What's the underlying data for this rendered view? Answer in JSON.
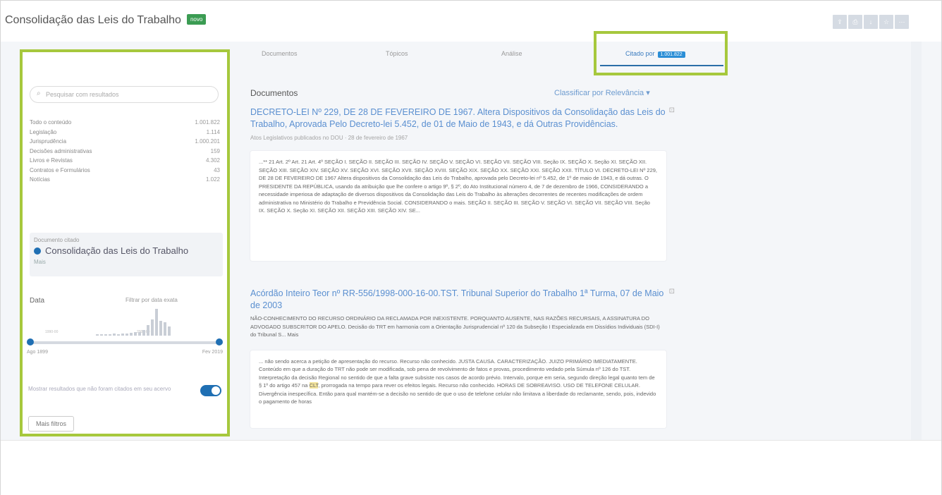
{
  "app": {
    "title": "Consolidação das Leis do Trabalho",
    "badge": "novo",
    "toolbar_icons": [
      "share-icon",
      "print-icon",
      "download-icon",
      "bookmark-icon",
      "more-icon"
    ]
  },
  "sidebar": {
    "search_placeholder": "Pesquisar com resultados",
    "facets": [
      {
        "label": "Todo o conteúdo",
        "count": "1.001.822"
      },
      {
        "label": "Legislação",
        "count": "1.114"
      },
      {
        "label": "Jurisprudência",
        "count": "1.000.201"
      },
      {
        "label": "Decisões administrativas",
        "count": "159"
      },
      {
        "label": "Livros e Revistas",
        "count": "4.302"
      },
      {
        "label": "Contratos e Formulários",
        "count": "43"
      },
      {
        "label": "Notícias",
        "count": "1.022"
      }
    ],
    "related": {
      "subtitle": "Documento citado",
      "main": "Consolidação das Leis do Trabalho",
      "more": "Mais"
    },
    "date": {
      "label": "Data",
      "filter_link": "Filtrar por data exata",
      "hist_labels": [
        "1990-00",
        "2000-00"
      ],
      "histogram": [
        0.05,
        0.05,
        0.06,
        0.05,
        0.08,
        0.06,
        0.07,
        0.09,
        0.1,
        0.12,
        0.14,
        0.2,
        0.4,
        0.6,
        1.0,
        0.55,
        0.5,
        0.35
      ],
      "range_low": 0.0,
      "range_high": 1.0,
      "min": "Ago 1899",
      "max": "Fev 2019"
    },
    "toggle_text": "Mostrar resultados que não foram citados em seu acervo",
    "toggle_on": true,
    "more_filters": "Mais filtros"
  },
  "tabs": [
    {
      "label": "Documentos"
    },
    {
      "label": "Tópicos"
    },
    {
      "label": "Análise"
    },
    {
      "label": "Citado por",
      "badge": "1.001.822",
      "active": true
    }
  ],
  "main": {
    "heading": "Documentos",
    "sort_label": "Classificar por Relevância ▾",
    "results": [
      {
        "title": "DECRETO-LEI Nº 229, DE 28 DE FEVEREIRO DE 1967. Altera Dispositivos da Consolidação das Leis do Trabalho, Aprovada Pelo Decreto-lei 5.452, de 01 de Maio de 1943, e dá Outras Providências.",
        "meta": "Atos Legislativos publicados no DOU · 28 de fevereiro de 1967",
        "snippet": "...** 21 Art. 2º Art. 21 Art. 4º SEÇÃO I. SEÇÃO II. SEÇÃO III. SEÇÃO IV. SEÇÃO V. SEÇÃO VI. SEÇÃO VII. SEÇÃO VIII. Seção IX. SEÇÃO X. Seção XI. SEÇÃO XII. SEÇÃO XIII. SEÇÃO XIV. SEÇÃO XV. SEÇÃO XVI. SEÇÃO XVII. SEÇÃO XVIII. SEÇÃO XIX. SEÇÃO XX. SEÇÃO XXI. SEÇÃO XXII. TÍTULO VI. DECRETO-LEI Nº 229, DE 28 DE FEVEREIRO DE 1967 Altera dispositivos da Consolidação das Leis do Trabalho, aprovada pelo Decreto-lei nº 5.452, de 1º de maio de 1943, e dá outras. O PRESIDENTE DA REPÚBLICA, usando da atribuição que lhe confere o artigo 9º, § 2º, do Ato Institucional número 4, de 7 de dezembro de 1966, CONSIDERANDO a necessidade imperiosa de adaptação de diversos dispositivos da Consolidação das Leis do Trabalho às alterações decorrentes de recentes modificações de ordem administrativa no Ministério do Trabalho e Previdência Social. CONSIDERANDO o mais. SEÇÃO II. SEÇÃO III. SEÇÃO V. SEÇÃO VI. SEÇÃO VII. SEÇÃO VIII. Seção IX. SEÇÃO X. Seção XI. SEÇÃO XII. SEÇÃO XIII. SEÇÃO XIV. SE..."
      },
      {
        "title": "Acórdão Inteiro Teor nº RR-556/1998-000-16-00.TST. Tribunal Superior do Trabalho 1ª Turma, 07 de Maio de 2003",
        "body": "NÃO-CONHECIMENTO DO RECURSO ORDINÁRIO DA RECLAMADA POR INEXISTENTE. PORQUANTO AUSENTE, NAS RAZÕES RECURSAIS, A ASSINATURA DO ADVOGADO SUBSCRITOR DO APELO. Decisão do TRT em harmonia com a Orientação Jurisprudencial nº 120 da Subseção I Especializada em Dissídios Individuais (SDI-I) do Tribunal S... Mais",
        "snippet_a": "... não sendo acerca a petição de apresentação do recurso. Recurso não conhecido. JUSTA CAUSA. CARACTERIZAÇÃO. JUIZO PRIMÁRIO IMEDIATAMENTE. Conteúdo em que a duração do TRT não pode ser modificada, sob pena de revolvimento de fatos e provas, procedimento vedado pela Súmula nº 126 do TST. Interpretação da decisão Regional no sentido de que a falta grave subsiste nos casos de acordo prévio. Intervalo, porque em seria, segundo direção legal quanto tem de § 1º do artigo 457 na",
        "snippet_hl": "CLT",
        "snippet_b": ", prorrogada na tempo para rever os efeitos legais. Recurso não conhecido. HORAS DE SOBREAVISO. USO DE TELEFONE CELULAR. Divergência inespecífica. Então para qual mantém-se a decisão no sentido de que o uso de telefone celular não limitava a liberdade do reclamante, sendo, pois, indevido o pagamento de horas"
      }
    ]
  }
}
